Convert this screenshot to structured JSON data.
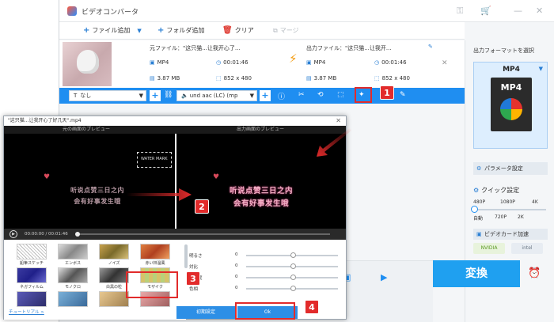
{
  "app": {
    "title": "ビデオコンバータ",
    "toolbar": {
      "add_file": "ファイル追加",
      "add_folder": "フォルダ追加",
      "clear": "クリア",
      "merge": "マージ"
    }
  },
  "file": {
    "source_label": "元ファイル：",
    "source_name": "\"这只猫...让我开心了…",
    "output_label": "出力ファイル：",
    "output_name": "\"这只猫...让我开...",
    "source_format": "MP4",
    "source_duration": "00:01:46",
    "source_size": "3.87 MB",
    "source_resolution": "852 x 480",
    "output_format": "MP4",
    "output_duration": "00:01:46",
    "output_size": "3.87 MB",
    "output_resolution": "852 x 480"
  },
  "actionbar": {
    "subtitle_select": "なし",
    "audio_select": "und aac (LC) (mp"
  },
  "right_panel": {
    "output_format_label": "出力フォーマットを選択",
    "format_name": "MP4",
    "format_icon_text": "MP4",
    "param_button": "パラメータ設定",
    "quick_settings": "クイック設定",
    "quality_top": [
      "480P",
      "1080P",
      "4K"
    ],
    "quality_bottom": [
      "自動",
      "720P",
      "2K"
    ],
    "gpu_button": "ビデオカード加速",
    "gpu_vendors": [
      "NVIDIA",
      "intel"
    ],
    "convert_button": "変換"
  },
  "dialog": {
    "title": "\"这只猫...让我开心了好几天\".mp4",
    "original_preview": "元の画面のプレビュー",
    "output_preview": "出力画面のプレビュー",
    "watermark_text": "WATER MARK",
    "subtitle_line1": "听说点赞三日之内",
    "subtitle_line2": "会有好事发生哦",
    "time": "00:00:00 / 00:01:46",
    "filters": [
      {
        "name": "鉛筆スケッチ"
      },
      {
        "name": "エンボス"
      },
      {
        "name": "ノイズ"
      },
      {
        "name": "赤い林温風"
      },
      {
        "name": "ネガフィルム"
      },
      {
        "name": "モノクロ"
      },
      {
        "name": "白黒の粒"
      },
      {
        "name": "モザイク"
      }
    ],
    "sliders": [
      {
        "name": "明るさ",
        "value": "0"
      },
      {
        "name": "対比",
        "value": "0"
      },
      {
        "name": "飽和度",
        "value": "0"
      },
      {
        "name": "色相",
        "value": "0"
      }
    ],
    "reset_button": "初期設定",
    "ok_button": "Ok",
    "tutorial_link": "チュートリアル >"
  },
  "callouts": [
    "1",
    "2",
    "3",
    "4"
  ],
  "colors": {
    "accent": "#1f8ef1",
    "highlight": "#e22b2b"
  }
}
